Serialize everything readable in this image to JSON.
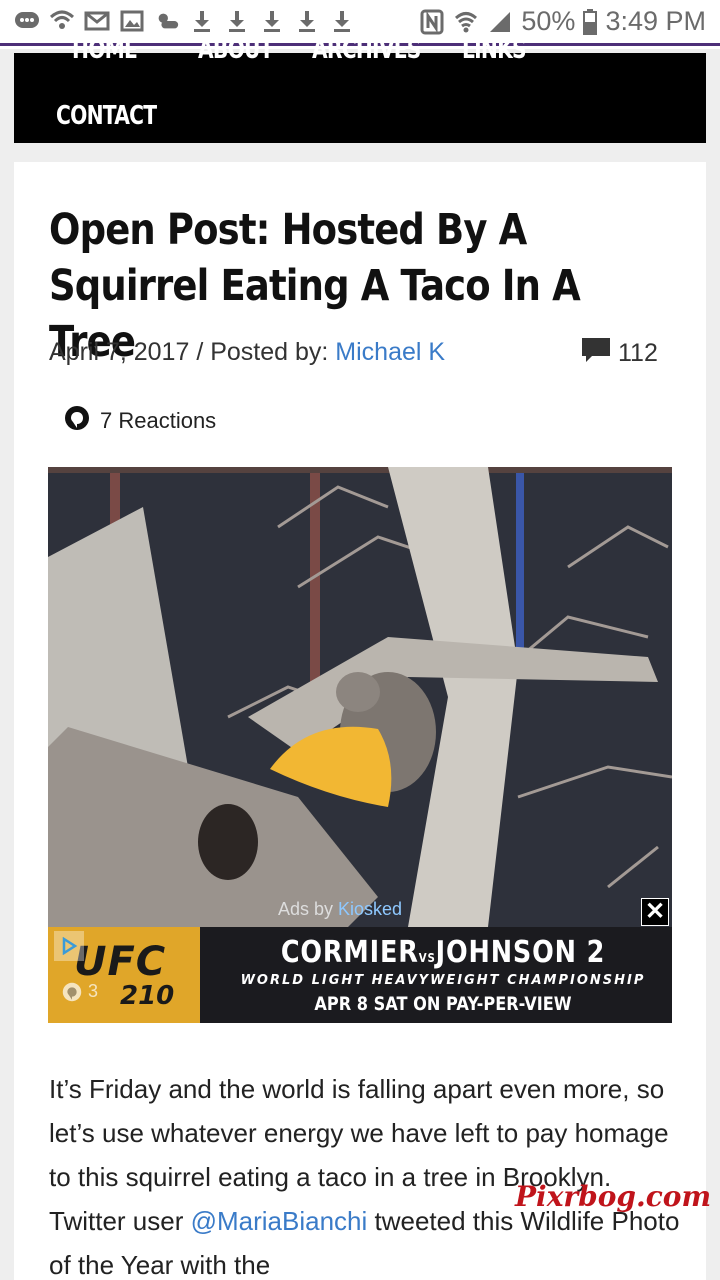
{
  "status_bar": {
    "battery": "50%",
    "time": "3:49 PM",
    "left_icons": [
      "chat-icon",
      "wifi-call-icon",
      "gmail-icon",
      "image-icon",
      "weather-icon",
      "download-icon",
      "download-icon",
      "download-icon",
      "download-icon",
      "download-icon"
    ],
    "right_icons": [
      "nfc-icon",
      "wifi-icon",
      "signal-icon",
      "battery-icon"
    ],
    "accent_color": "#4d2f78"
  },
  "nav": {
    "items": [
      "HOME",
      "ABOUT",
      "ARCHIVES",
      "LINKS"
    ],
    "contact": "CONTACT"
  },
  "post": {
    "title": "Open Post: Hosted By A Squirrel Eating A Taco In A Tree",
    "date_prefix": "April 7, 2017 / Posted by: ",
    "author": "Michael K",
    "comment_count": "112",
    "reactions": "7 Reactions"
  },
  "ad": {
    "label_prefix": "Ads by ",
    "label_brand": "Kiosked",
    "close": "✕",
    "logo_text": "UFC",
    "logo_number": "210",
    "views": "3",
    "headline_left": "CORMIER",
    "headline_vs": "VS",
    "headline_right": "JOHNSON 2",
    "subline": "WORLD LIGHT HEAVYWEIGHT CHAMPIONSHIP",
    "date_line": "APR 8 SAT ON PAY-PER-VIEW"
  },
  "body": {
    "text_1": "It’s Friday and the world is falling apart even more, so let’s use whatever energy we have left to pay homage to this squirrel eating a taco in a tree in Brooklyn. Twitter user ",
    "mention": "@MariaBianchi",
    "text_2": " tweeted this Wildlife Photo of the Year with the"
  },
  "watermark": "Pixrbog.com"
}
